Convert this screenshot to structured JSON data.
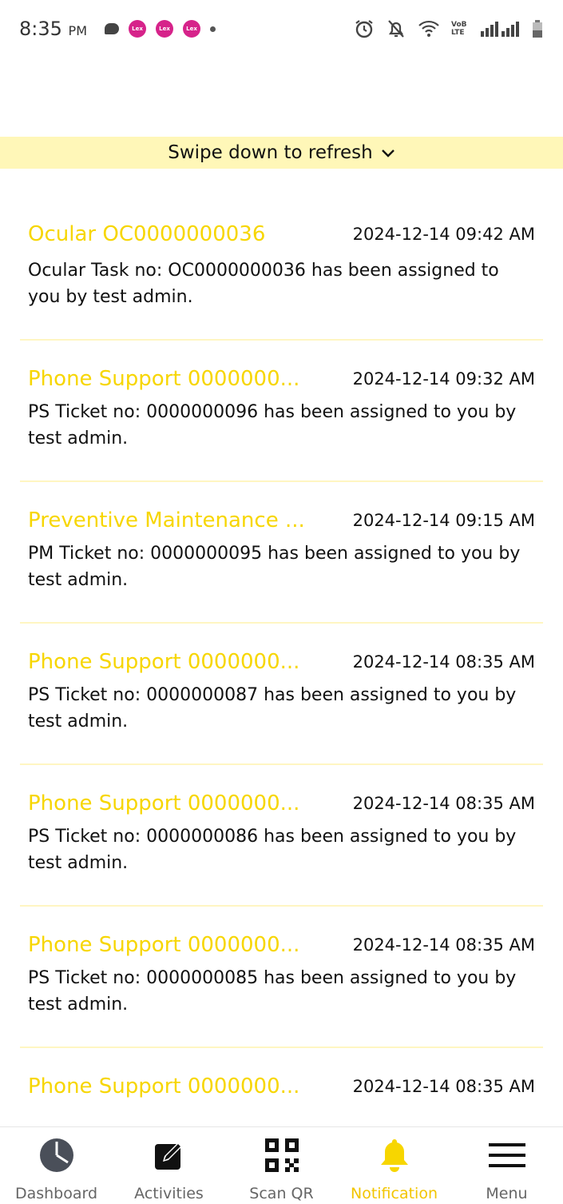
{
  "status_bar": {
    "time": "8:35",
    "ampm": "PM",
    "volte_label": "VoB LTE"
  },
  "refresh": {
    "label": "Swipe down to refresh"
  },
  "notifications": [
    {
      "title": "Ocular OC0000000036",
      "time": "2024-12-14 09:42 AM",
      "body": "Ocular Task no: OC0000000036 has been assigned to you by test admin."
    },
    {
      "title": "Phone Support 0000000...",
      "time": "2024-12-14 09:32 AM",
      "body": "PS Ticket no: 0000000096 has been assigned to you by test admin."
    },
    {
      "title": "Preventive Maintenance ...",
      "time": "2024-12-14 09:15 AM",
      "body": "PM Ticket no: 0000000095 has been assigned to you by test admin."
    },
    {
      "title": "Phone Support 0000000...",
      "time": "2024-12-14 08:35 AM",
      "body": "PS Ticket no: 0000000087 has been assigned to you by test admin."
    },
    {
      "title": "Phone Support 0000000...",
      "time": "2024-12-14 08:35 AM",
      "body": "PS Ticket no: 0000000086 has been assigned to you by test admin."
    },
    {
      "title": "Phone Support 0000000...",
      "time": "2024-12-14 08:35 AM",
      "body": "PS Ticket no: 0000000085 has been assigned to you by test admin."
    },
    {
      "title": "Phone Support 0000000...",
      "time": "2024-12-14 08:35 AM",
      "body": ""
    }
  ],
  "nav": {
    "dashboard": "Dashboard",
    "activities": "Activities",
    "scan_qr": "Scan QR",
    "notification": "Notification",
    "menu": "Menu"
  },
  "colors": {
    "accent": "#f7d600",
    "refresh_bg": "#fff7b8",
    "divider": "#fff6c2"
  }
}
